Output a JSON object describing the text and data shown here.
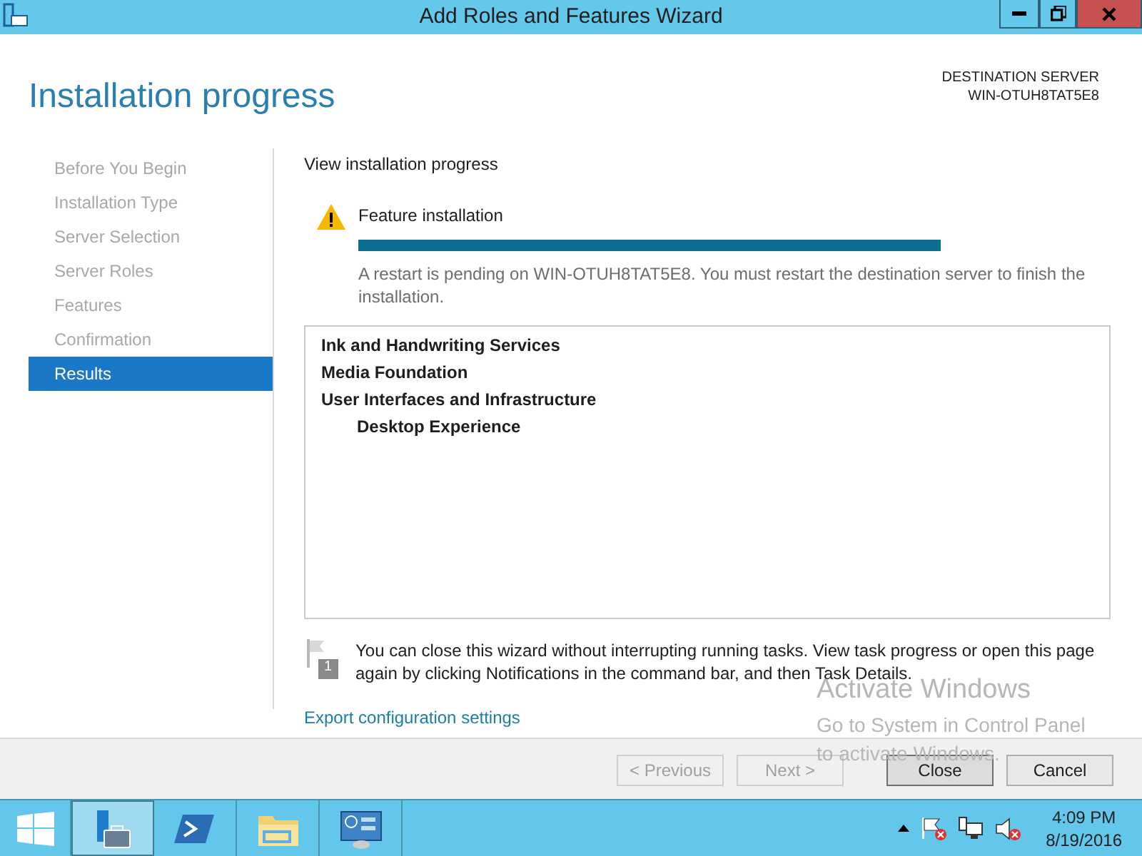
{
  "window": {
    "title": "Add Roles and Features Wizard"
  },
  "header": {
    "title": "Installation progress",
    "destination_label": "DESTINATION SERVER",
    "destination_server": "WIN-OTUH8TAT5E8"
  },
  "steps": [
    {
      "label": "Before You Begin",
      "selected": false
    },
    {
      "label": "Installation Type",
      "selected": false
    },
    {
      "label": "Server Selection",
      "selected": false
    },
    {
      "label": "Server Roles",
      "selected": false
    },
    {
      "label": "Features",
      "selected": false
    },
    {
      "label": "Confirmation",
      "selected": false
    },
    {
      "label": "Results",
      "selected": true
    }
  ],
  "content": {
    "heading": "View installation progress",
    "status": {
      "kind": "warning",
      "title": "Feature installation",
      "level": 1,
      "message": "A restart is pending on WIN-OTUH8TAT5E8. You must restart the destination server to finish the installation."
    },
    "features": [
      {
        "label": "Ink and Handwriting Services"
      },
      {
        "label": "Media Foundation"
      },
      {
        "label": "User Interfaces and Infrastructure",
        "children": [
          {
            "label": "Desktop Experience"
          }
        ]
      }
    ],
    "note_badge": "1",
    "note": "You can close this wizard without interrupting running tasks. View task progress or open this page again by clicking Notifications in the command bar, and then Task Details.",
    "export_link": "Export configuration settings"
  },
  "buttons": [
    {
      "label": "< Previous",
      "disabled": true,
      "default": false
    },
    {
      "label": "Next >",
      "disabled": true,
      "default": false
    },
    {
      "label": "Close",
      "disabled": false,
      "default": true
    },
    {
      "label": "Cancel",
      "disabled": false,
      "default": false
    }
  ],
  "watermark": {
    "title": "Activate Windows",
    "lines": [
      "Go to System in Control Panel",
      "to activate Windows."
    ]
  },
  "taskbar": {
    "apps": [
      {
        "kind": "server-manager",
        "selected": true
      },
      {
        "kind": "powershell",
        "selected": false
      },
      {
        "kind": "explorer",
        "selected": false
      },
      {
        "kind": "control-panel",
        "selected": false
      }
    ],
    "clock": {
      "time": "4:09 PM",
      "date": "8/19/2016"
    }
  }
}
